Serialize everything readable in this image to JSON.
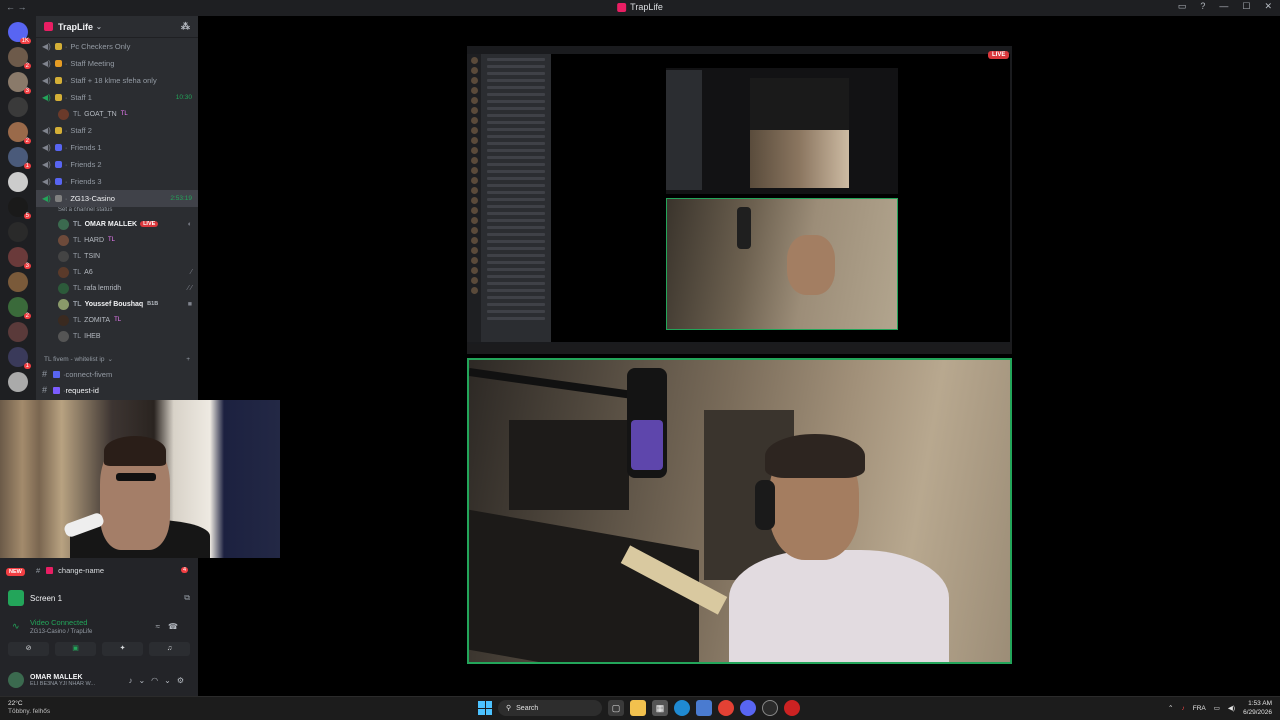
{
  "window": {
    "title": "TrapLife",
    "nav": "←   →"
  },
  "server": {
    "name": "TrapLife"
  },
  "channels": [
    {
      "name": "Pc Checkers Only",
      "emoji_color": "#d4af37"
    },
    {
      "name": "Staff Meeting",
      "emoji_color": "#e69c24"
    },
    {
      "name": "Staff + 18 klme sfeha only",
      "emoji_color": "#d4af37"
    },
    {
      "name": "Staff 1",
      "emoji_color": "#d4af37",
      "timer": "10:30"
    }
  ],
  "staff1_member": {
    "tag": "TL",
    "name": "GOAT_TN",
    "badge": "TL"
  },
  "channels2": [
    {
      "name": "Staff 2",
      "emoji_color": "#d4af37"
    },
    {
      "name": "Friends 1",
      "emoji_color": "#5865f2"
    },
    {
      "name": "Friends 2",
      "emoji_color": "#5865f2"
    },
    {
      "name": "Friends 3",
      "emoji_color": "#5865f2"
    }
  ],
  "active_channel": {
    "name": "ZG13-Casino",
    "timer": "2:53:19",
    "status": "Set a channel status"
  },
  "members": [
    {
      "tag": "TL",
      "name": "OMAR MALLEK",
      "live": "LIVE",
      "av": "#3b6a4f",
      "bold": true
    },
    {
      "tag": "TL",
      "name": "HARD",
      "badge": "TL",
      "av": "#6d4a3a"
    },
    {
      "tag": "TL",
      "name": "TSIN",
      "av": "#444"
    },
    {
      "tag": "TL",
      "name": "A6",
      "av": "#5a3a2a"
    },
    {
      "tag": "TL",
      "name": "rafa lemridh",
      "av": "#2c5a3a"
    },
    {
      "tag": "TL",
      "name": "Youssef Boushaq",
      "badge": "B1B",
      "av": "#8a9a6a",
      "bold": true
    },
    {
      "tag": "TL",
      "name": "ZOMITA",
      "badge": "TL",
      "av": "#3a2a20"
    },
    {
      "tag": "TL",
      "name": "IHEB",
      "av": "#555"
    }
  ],
  "category": {
    "name": "TL fivem - whitelist ip"
  },
  "text_channels": [
    {
      "name": "connect-fivem"
    },
    {
      "name": "request-id"
    }
  ],
  "lower": {
    "new_badge": "NEW",
    "change_channel": "change-name",
    "change_notif": "4",
    "screen_label": "Screen 1",
    "vc_status": "Video Connected",
    "vc_where": "ZG13-Casino / TrapLife",
    "user_name": "OMAR MALLEK",
    "user_status": "ELI BE3NA YJI NHAR W..."
  },
  "stream": {
    "live_label": "LIVE"
  },
  "taskbar": {
    "temp": "22°C",
    "weather": "Többny. felhős",
    "search": "Search",
    "lang": "FRA",
    "time": "1:53 AM",
    "date": "6/29/2026"
  }
}
